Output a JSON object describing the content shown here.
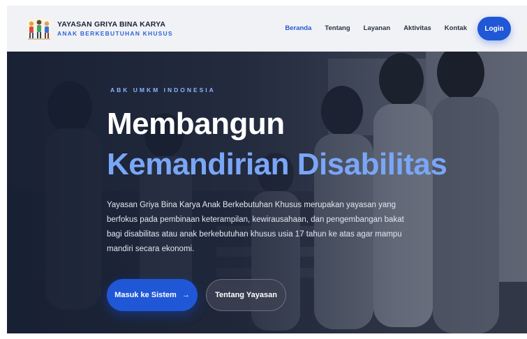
{
  "brand": {
    "title": "YAYASAN GRIYA BINA KARYA",
    "subtitle": "ANAK BERKEBUTUHAN KHUSUS",
    "logo_icon": "children-group-logo"
  },
  "nav": {
    "items": [
      {
        "label": "Beranda",
        "active": true
      },
      {
        "label": "Tentang",
        "active": false
      },
      {
        "label": "Layanan",
        "active": false
      },
      {
        "label": "Aktivitas",
        "active": false
      },
      {
        "label": "Kontak",
        "active": false
      }
    ],
    "login_label": "Login"
  },
  "hero": {
    "eyebrow": "ABK UMKM INDONESIA",
    "title_line1": "Membangun",
    "title_line2": "Kemandirian Disabilitas",
    "description": "Yayasan Griya Bina Karya Anak Berkebutuhan Khusus merupakan yayasan yang berfokus pada pembinaan keterampilan, kewirausahaan, dan pengembangan bakat bagi disabilitas atau anak berkebutuhan khusus usia 17 tahun ke atas agar mampu mandiri secara ekonomi.",
    "primary_button": "Masuk ke Sistem",
    "primary_button_icon": "→",
    "secondary_button": "Tentang Yayasan",
    "background_image": "children-group-photo"
  },
  "colors": {
    "accent": "#1f57d6",
    "title_highlight": "#7aa6f7",
    "eyebrow": "#8fb3ff",
    "navbar_bg": "#f1f2f6"
  }
}
